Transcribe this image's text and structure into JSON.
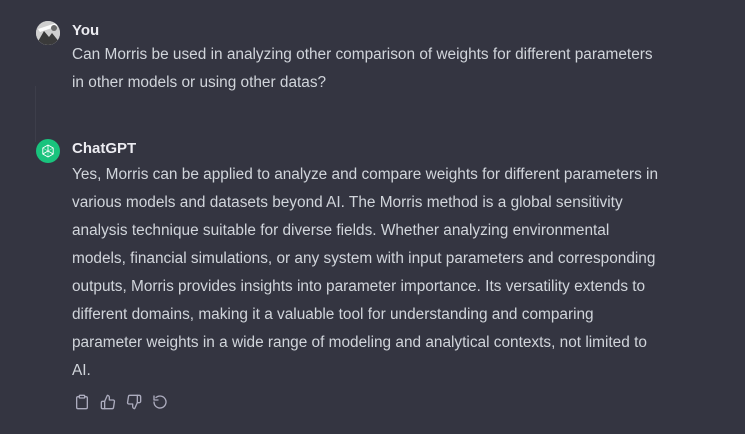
{
  "user_message": {
    "author": "You",
    "lines": [
      "Can Morris be used in analyzing other comparison of weights for different parameters",
      "in other models or using other datas?"
    ]
  },
  "assistant_message": {
    "author": "ChatGPT",
    "lines": [
      "Yes, Morris can be applied to analyze and compare weights for different parameters in",
      "various models and datasets beyond AI. The Morris method is a global sensitivity",
      "analysis technique suitable for diverse fields. Whether analyzing environmental",
      "models, financial simulations, or any system with input parameters and corresponding",
      "outputs, Morris provides insights into parameter importance. Its versatility extends to",
      "different domains, making it a valuable tool for understanding and comparing",
      "parameter weights in a wide range of modeling and analytical contexts, not limited to",
      "AI."
    ]
  },
  "actions": [
    {
      "name": "copy-icon"
    },
    {
      "name": "thumbs-up-icon"
    },
    {
      "name": "thumbs-down-icon"
    },
    {
      "name": "regenerate-icon"
    }
  ],
  "colors": {
    "background": "#343541",
    "text": "#d1d5db",
    "author": "#ececf1",
    "openai_green": "#19c37d",
    "icon": "#acacbe"
  }
}
